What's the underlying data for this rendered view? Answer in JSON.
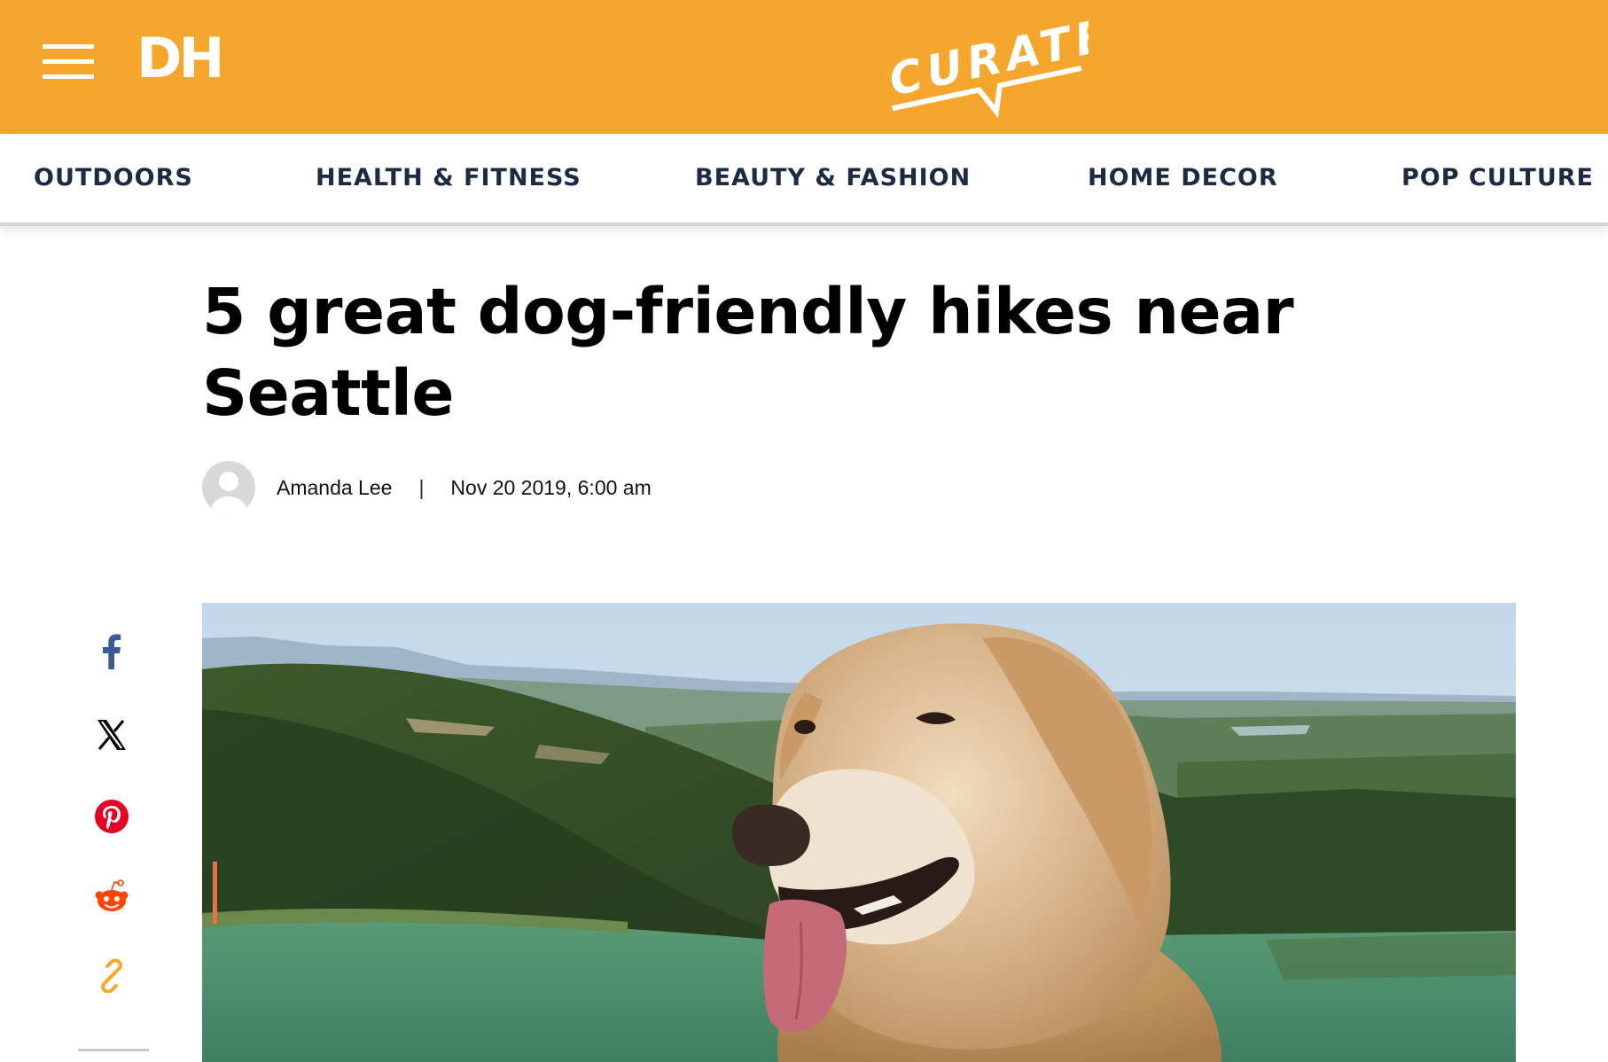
{
  "header": {
    "logo_text": "DH",
    "brand_text": "CURATED",
    "background_color": "#f5a72d"
  },
  "nav": {
    "items": [
      {
        "label": "OUTDOORS"
      },
      {
        "label": "HEALTH & FITNESS"
      },
      {
        "label": "BEAUTY & FASHION"
      },
      {
        "label": "HOME DECOR"
      },
      {
        "label": "POP CULTURE"
      }
    ],
    "text_color": "#1d2a44"
  },
  "article": {
    "headline_line1": "5 great dog-friendly hikes near",
    "headline_line2": "Seattle",
    "author": "Amanda Lee",
    "separator": "|",
    "date": "Nov 20 2019, 6:00 am"
  },
  "share": {
    "icons": [
      "facebook-icon",
      "x-icon",
      "pinterest-icon",
      "reddit-icon",
      "link-icon"
    ],
    "colors": {
      "facebook": "#3b5998",
      "x": "#000000",
      "pinterest": "#e60023",
      "reddit": "#ff4500",
      "link": "#f5a72d"
    }
  }
}
